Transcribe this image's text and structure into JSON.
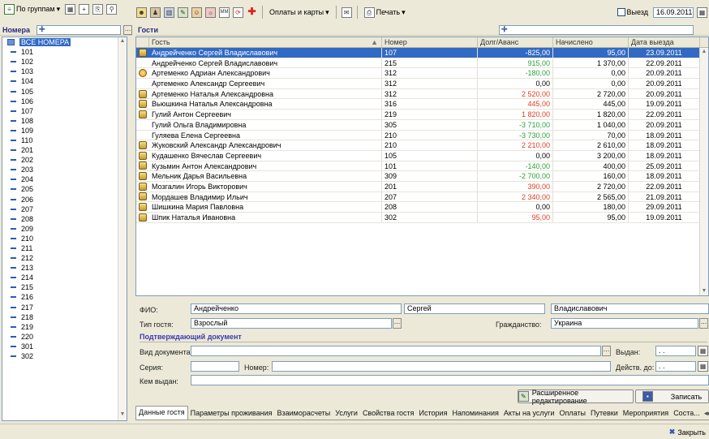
{
  "left_toolbar": {
    "group_label": "По группам"
  },
  "rooms_panel": {
    "title": "Номера",
    "search_value": "",
    "items": [
      "ВСЕ НОМЕРА",
      "101",
      "102",
      "103",
      "104",
      "105",
      "106",
      "107",
      "108",
      "109",
      "110",
      "201",
      "202",
      "203",
      "204",
      "205",
      "206",
      "207",
      "208",
      "209",
      "210",
      "211",
      "212",
      "213",
      "214",
      "215",
      "216",
      "217",
      "218",
      "219",
      "220",
      "301",
      "302"
    ]
  },
  "right_toolbar": {
    "payments_label": "Оплаты и карты",
    "print_label": "Печать",
    "departure_label": "Выезд",
    "departure_date": "16.09.2011"
  },
  "guests_panel": {
    "title": "Гости",
    "search_value": ""
  },
  "grid": {
    "columns": [
      "Гость",
      "Номер",
      "Долг/Аванс",
      "Начислено",
      "Дата выезда"
    ],
    "rows": [
      {
        "icon": "guest-icon",
        "name": "Андрейченко Сергей Владиславович",
        "room": "107",
        "debt": "-825,00",
        "debt_color": "red",
        "charged": "95,00",
        "date": "23.09.2011",
        "selected": true
      },
      {
        "icon": "",
        "name": "Андрейченко Сергей Владиславович",
        "room": "215",
        "debt": "915,00",
        "debt_color": "green",
        "charged": "1 370,00",
        "date": "22.09.2011"
      },
      {
        "icon": "vip-icon",
        "name": "Артеменко Адриан Александрович",
        "room": "312",
        "debt": "-180,00",
        "debt_color": "green",
        "charged": "0,00",
        "date": "20.09.2011"
      },
      {
        "icon": "",
        "name": "Артеменко Александр Сергеевич",
        "room": "312",
        "debt": "0,00",
        "debt_color": "",
        "charged": "0,00",
        "date": "20.09.2011"
      },
      {
        "icon": "guest-icon",
        "name": "Артеменко Наталья Александровна",
        "room": "312",
        "debt": "2 520,00",
        "debt_color": "red",
        "charged": "2 720,00",
        "date": "20.09.2011"
      },
      {
        "icon": "guest-icon",
        "name": "Вьюшкина Наталья Александровна",
        "room": "316",
        "debt": "445,00",
        "debt_color": "red",
        "charged": "445,00",
        "date": "19.09.2011"
      },
      {
        "icon": "guest-icon",
        "name": "Гулий Антон Сергеевич",
        "room": "219",
        "debt": "1 820,00",
        "debt_color": "red",
        "charged": "1 820,00",
        "date": "22.09.2011"
      },
      {
        "icon": "",
        "name": "Гулий Ольга Владимировна",
        "room": "305",
        "debt": "-3 710,00",
        "debt_color": "green",
        "charged": "1 040,00",
        "date": "20.09.2011"
      },
      {
        "icon": "",
        "name": "Гуляева Елена Сергеевна",
        "room": "210",
        "debt": "-3 730,00",
        "debt_color": "green",
        "charged": "70,00",
        "date": "18.09.2011"
      },
      {
        "icon": "guest-icon",
        "name": "Жуковский Александр Александрович",
        "room": "210",
        "debt": "2 210,00",
        "debt_color": "red",
        "charged": "2 610,00",
        "date": "18.09.2011"
      },
      {
        "icon": "guest-icon",
        "name": "Кудашенко Вячеслав Сергеевич",
        "room": "105",
        "debt": "0,00",
        "debt_color": "",
        "charged": "3 200,00",
        "date": "18.09.2011"
      },
      {
        "icon": "guest-icon",
        "name": "Кузьмин Антон Александрович",
        "room": "101",
        "debt": "-140,00",
        "debt_color": "green",
        "charged": "400,00",
        "date": "25.09.2011"
      },
      {
        "icon": "guest-icon",
        "name": "Мельник Дарья Васильевна",
        "room": "309",
        "debt": "-2 700,00",
        "debt_color": "green",
        "charged": "160,00",
        "date": "18.09.2011"
      },
      {
        "icon": "guest-icon",
        "name": "Мозгалин Игорь Викторович",
        "room": "201",
        "debt": "390,00",
        "debt_color": "red",
        "charged": "2 720,00",
        "date": "22.09.2011"
      },
      {
        "icon": "guest-icon",
        "name": "Мордашев Владимир Ильич",
        "room": "207",
        "debt": "2 340,00",
        "debt_color": "red",
        "charged": "2 565,00",
        "date": "21.09.2011"
      },
      {
        "icon": "guest-icon",
        "name": "Шишкина Мария Павловна",
        "room": "208",
        "debt": "0,00",
        "debt_color": "",
        "charged": "180,00",
        "date": "29.09.2011"
      },
      {
        "icon": "guest-icon",
        "name": "Шпик Наталья Ивановна",
        "room": "302",
        "debt": "95,00",
        "debt_color": "red",
        "charged": "95,00",
        "date": "19.09.2011"
      }
    ]
  },
  "form": {
    "fio_label": "ФИО:",
    "last_name": "Андрейченко",
    "first_name": "Сергей",
    "middle_name": "Владиславович",
    "guest_type_label": "Тип гостя:",
    "guest_type": "Взрослый",
    "citizenship_label": "Гражданство:",
    "citizenship": "Украина",
    "doc_section": "Подтверждающий документ",
    "doc_type_label": "Вид документа:",
    "issued_label": "Выдан:",
    "issued_value": ". .",
    "series_label": "Серия:",
    "number_label": "Номер:",
    "valid_label": "Действ. до:",
    "valid_value": ". .",
    "issued_by_label": "Кем выдан:",
    "ext_edit_label": "Расширенное редактирование",
    "save_label": "Записать"
  },
  "tabs": [
    "Данные гостя",
    "Параметры проживания",
    "Взаиморасчеты",
    "Услуги",
    "Свойства гостя",
    "История",
    "Напоминания",
    "Акты на услуги",
    "Оплаты",
    "Путевки",
    "Мероприятия",
    "Соста..."
  ],
  "status": {
    "close_label": "Закрыть"
  },
  "colors": {
    "selection": "#316ac5",
    "debt_red": "#e03c22",
    "debt_green": "#29a23a",
    "accent_title": "#3b3bb0"
  }
}
